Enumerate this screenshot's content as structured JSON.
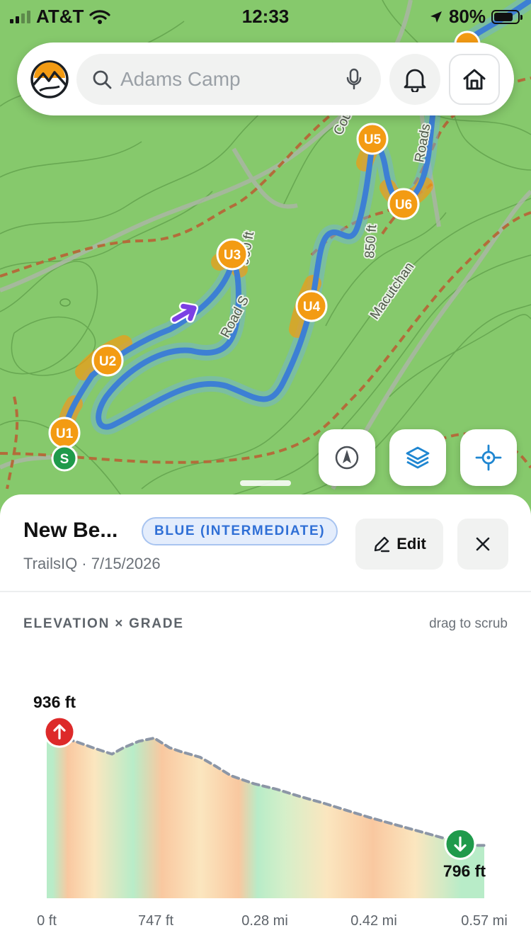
{
  "status_bar": {
    "carrier": "AT&T",
    "time": "12:33",
    "battery": "80%",
    "battery_level": 0.8
  },
  "search": {
    "placeholder": "Adams Camp",
    "icons": [
      "app-logo",
      "search-icon",
      "mic-icon",
      "bell-icon",
      "home-icon"
    ]
  },
  "map": {
    "contour_labels": [
      "900 ft",
      "850 ft"
    ],
    "road_labels": [
      "Macutchan",
      "Road S",
      "Cou",
      "Roads"
    ],
    "segment_markers": [
      "U1",
      "U2",
      "U3",
      "U4",
      "U5",
      "U6"
    ],
    "start_marker": "S",
    "colors": {
      "terrain": "#86c96c",
      "route": "#3d7fd4",
      "marker": "#f39b13",
      "start": "#1f9a4b",
      "direction_arrow": "#7b3fe4"
    },
    "controls": [
      "compass-icon",
      "layers-icon",
      "locate-icon"
    ]
  },
  "route": {
    "title": "New Be...",
    "difficulty": "BLUE (INTERMEDIATE)",
    "meta": "TrailsIQ · 7/15/2026",
    "edit_label": "Edit"
  },
  "elevation": {
    "section_title": "ELEVATION × GRADE",
    "hint": "drag to scrub"
  },
  "chart_data": {
    "type": "area",
    "title": "ELEVATION × GRADE",
    "x_tick_labels": [
      "0 ft",
      "747 ft",
      "0.28 mi",
      "0.42 mi",
      "0.57 mi"
    ],
    "x_mi": [
      0,
      0.015,
      0.04,
      0.06,
      0.085,
      0.1,
      0.12,
      0.14,
      0.16,
      0.175,
      0.2,
      0.22,
      0.24,
      0.27,
      0.3,
      0.33,
      0.36,
      0.39,
      0.42,
      0.45,
      0.48,
      0.51,
      0.54,
      0.555,
      0.57
    ],
    "elevation_ft": [
      936,
      932,
      925,
      918,
      910,
      918,
      926,
      930,
      918,
      913,
      906,
      895,
      883,
      873,
      866,
      857,
      849,
      840,
      831,
      823,
      815,
      807,
      799,
      796,
      796
    ],
    "xlim": [
      0,
      0.57
    ],
    "ylim": [
      730,
      960
    ],
    "max_label": "936 ft",
    "min_label": "796 ft",
    "grade_bands": [
      {
        "from": 0,
        "to": 0.015,
        "color": "#b8ecc8"
      },
      {
        "from": 0.015,
        "to": 0.04,
        "color": "#f9c8a0"
      },
      {
        "from": 0.04,
        "to": 0.085,
        "color": "#fbe6bf"
      },
      {
        "from": 0.085,
        "to": 0.14,
        "color": "#b8ecc8"
      },
      {
        "from": 0.14,
        "to": 0.16,
        "color": "#f9c8a0"
      },
      {
        "from": 0.16,
        "to": 0.24,
        "color": "#fbe6bf"
      },
      {
        "from": 0.24,
        "to": 0.26,
        "color": "#f9c8a0"
      },
      {
        "from": 0.26,
        "to": 0.29,
        "color": "#b8ecc8"
      },
      {
        "from": 0.29,
        "to": 0.33,
        "color": "#d5efc9"
      },
      {
        "from": 0.33,
        "to": 0.4,
        "color": "#fbe6bf"
      },
      {
        "from": 0.4,
        "to": 0.45,
        "color": "#f9c8a0"
      },
      {
        "from": 0.45,
        "to": 0.51,
        "color": "#fbe6bf"
      },
      {
        "from": 0.51,
        "to": 0.57,
        "color": "#b8ecc8"
      }
    ],
    "colors": {
      "profile_line": "#8c96a6",
      "max_marker": "#dd2a2a",
      "min_marker": "#1f9a4b"
    },
    "grid": false
  }
}
